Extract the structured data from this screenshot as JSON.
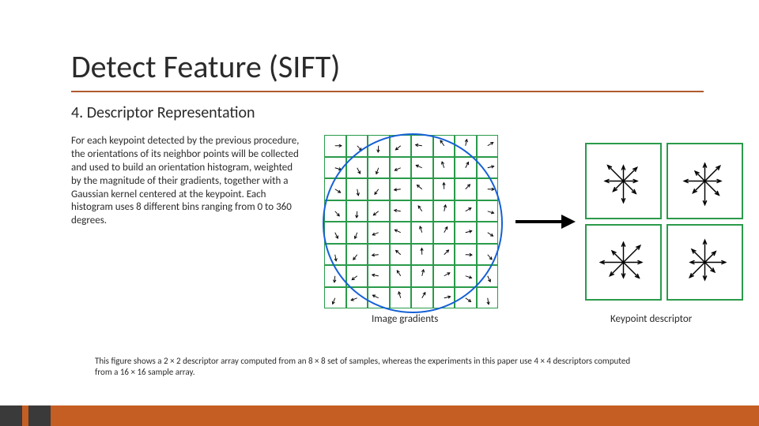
{
  "title": "Detect Feature (SIFT)",
  "subtitle": "4. Descriptor Representation",
  "paragraph": "For each keypoint detected by the previous procedure, the orientations of its neighbor points will be collected and used to build an orientation histogram, weighted by the magnitude of their gradients, together with a Gaussian kernel centered at the keypoint.  Each histogram uses 8 different bins ranging from 0 to 360 degrees.",
  "caption_left": "Image gradients",
  "caption_right": "Keypoint descriptor",
  "footnote": "This figure shows a 2 × 2 descriptor array computed from an 8 × 8 set of samples, whereas the experiments in this paper use 4 × 4 descriptors computed from a 16 × 16 sample array.",
  "colors": {
    "accent": "#c55e22",
    "grid": "#2a9b4a",
    "circle": "#1560d6"
  },
  "figure": {
    "left_grid": "8x8 image-gradient cells with one small arrow each",
    "right_grid": "2x2 keypoint-descriptor cells with 8-direction star each",
    "middle_arrow": "large right-pointing arrow"
  }
}
